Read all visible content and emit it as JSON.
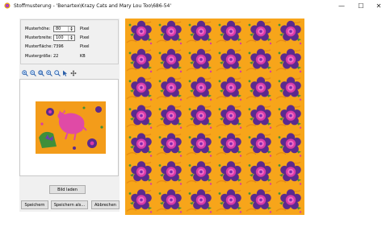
{
  "window": {
    "title": "Stoffmusterung - 'Benartex\\Krazy Cats and Mary Lou Too\\686-54'",
    "minimize_glyph": "—",
    "maximize_glyph": "☐",
    "close_glyph": "✕"
  },
  "info": {
    "height_label": "Musterhöhe:",
    "height_value": "80",
    "height_unit": "Pixel",
    "width_label": "Musterbreite:",
    "width_value": "100",
    "width_unit": "Pixel",
    "area_label": "Musterfläche:",
    "area_value": "7396",
    "area_unit": "Pixel",
    "size_label": "Mustergröße:",
    "size_value": "22",
    "size_unit": "KB"
  },
  "toolbar": {
    "icons": [
      "zoom-in-icon",
      "zoom-out-icon",
      "zoom-fit-icon",
      "zoom-actual-icon",
      "zoom-window-icon",
      "select-arrow-icon",
      "pan-move-icon"
    ]
  },
  "buttons": {
    "load_image": "Bild laden",
    "save": "Speichern",
    "save_as": "Speichern als...",
    "cancel": "Abbrechen"
  },
  "colors": {
    "fabric_background": "#f7a51a",
    "flower_petal": "#5b2a8e",
    "flower_center": "#d93aa8",
    "leaf": "#3f8f3a"
  }
}
